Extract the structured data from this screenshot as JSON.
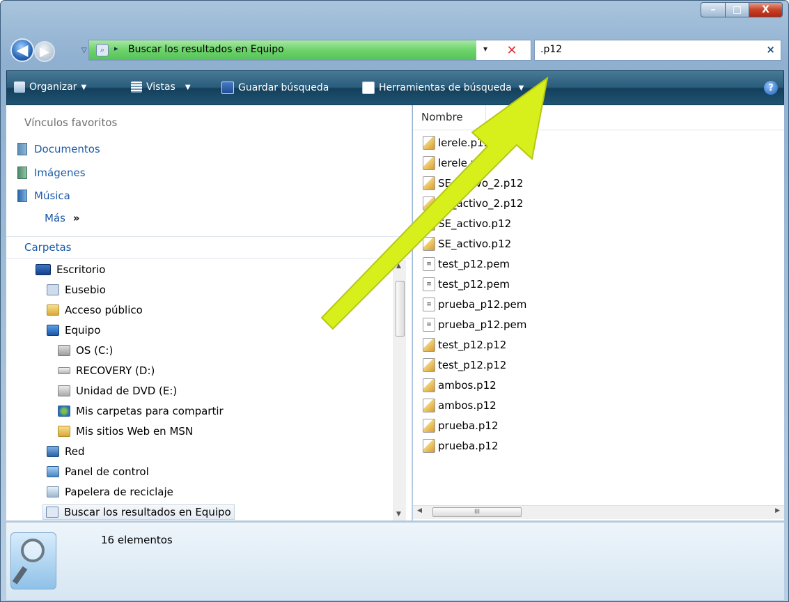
{
  "window": {
    "controls": {
      "minimize": "–",
      "maximize": "□",
      "close": "X"
    }
  },
  "nav": {
    "back_icon": "back-arrow-icon",
    "forward_icon": "forward-arrow-icon",
    "back_glyph": "◀",
    "forward_glyph": "▶",
    "history_dropdown_glyph": "▽",
    "address": {
      "separator": "▸",
      "text": "Buscar los resultados en Equipo",
      "dropdown_glyph": "▾",
      "clear_glyph": "✕"
    },
    "search": {
      "value": ".p12",
      "clear_glyph": "×"
    }
  },
  "toolbar": {
    "organize": "Organizar",
    "views": "Vistas",
    "save_search": "Guardar búsqueda",
    "search_tools": "Herramientas de búsqueda",
    "dropdown_glyph": "▼",
    "help": "?"
  },
  "left": {
    "favorites_heading": "Vínculos favoritos",
    "favorites": [
      {
        "label": "Documentos",
        "icon": "documents-icon"
      },
      {
        "label": "Imágenes",
        "icon": "pictures-icon"
      },
      {
        "label": "Música",
        "icon": "music-icon"
      }
    ],
    "more": "Más",
    "more_glyph": "»",
    "folders_heading": "Carpetas",
    "tree": [
      {
        "label": "Escritorio",
        "icon": "desktop-icon",
        "level": 0
      },
      {
        "label": "Eusebio",
        "icon": "user-folder-icon",
        "level": 1
      },
      {
        "label": "Acceso público",
        "icon": "folder-icon",
        "level": 1
      },
      {
        "label": "Equipo",
        "icon": "computer-icon",
        "level": 1
      },
      {
        "label": "OS (C:)",
        "icon": "drive-c-icon",
        "level": 2
      },
      {
        "label": "RECOVERY (D:)",
        "icon": "drive-icon",
        "level": 2
      },
      {
        "label": "Unidad de DVD (E:)",
        "icon": "dvd-drive-icon",
        "level": 2
      },
      {
        "label": "Mis carpetas para compartir",
        "icon": "shared-folders-icon",
        "level": 2
      },
      {
        "label": "Mis sitios Web en MSN",
        "icon": "folder-icon",
        "level": 2
      },
      {
        "label": "Red",
        "icon": "network-icon",
        "level": 1
      },
      {
        "label": "Panel de control",
        "icon": "control-panel-icon",
        "level": 1
      },
      {
        "label": "Papelera de reciclaje",
        "icon": "recycle-bin-icon",
        "level": 1
      },
      {
        "label": "Buscar los resultados en Equipo",
        "icon": "search-results-icon",
        "level": 1,
        "selected": true
      }
    ]
  },
  "files": {
    "column_name": "Nombre",
    "items": [
      {
        "name": "lerele.p12",
        "type": "cert"
      },
      {
        "name": "lerele.p12",
        "type": "cert"
      },
      {
        "name": "SE_activo_2.p12",
        "type": "cert"
      },
      {
        "name": "SE_activo_2.p12",
        "type": "cert"
      },
      {
        "name": "SE_activo.p12",
        "type": "cert"
      },
      {
        "name": "SE_activo.p12",
        "type": "cert"
      },
      {
        "name": "test_p12.pem",
        "type": "pem"
      },
      {
        "name": "test_p12.pem",
        "type": "pem"
      },
      {
        "name": "prueba_p12.pem",
        "type": "pem"
      },
      {
        "name": "prueba_p12.pem",
        "type": "pem"
      },
      {
        "name": "test_p12.p12",
        "type": "cert"
      },
      {
        "name": "test_p12.p12",
        "type": "cert"
      },
      {
        "name": "ambos.p12",
        "type": "cert"
      },
      {
        "name": "ambos.p12",
        "type": "cert"
      },
      {
        "name": "prueba.p12",
        "type": "cert"
      },
      {
        "name": "prueba.p12",
        "type": "cert"
      }
    ],
    "scroll_grip": "III"
  },
  "status": {
    "count": "16 elementos"
  },
  "annotation": {
    "color": "#d7ef1a"
  }
}
